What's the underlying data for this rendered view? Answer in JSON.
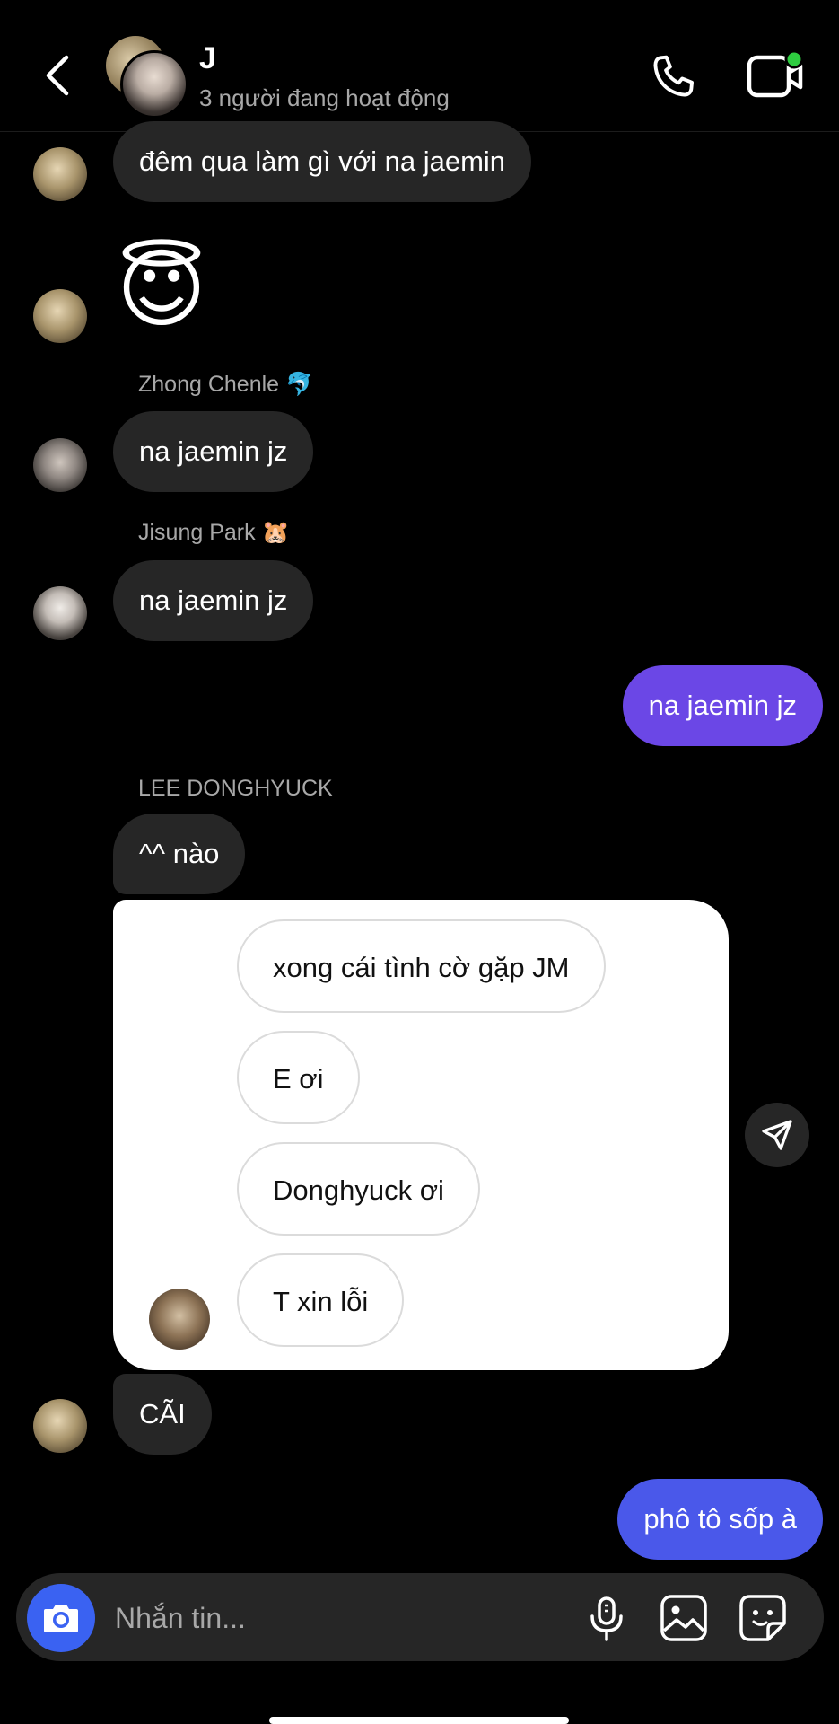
{
  "header": {
    "title": "J",
    "subtitle": "3 người đang hoạt động"
  },
  "messages": [
    {
      "text": "đêm qua làm gì với na jaemin"
    },
    {
      "emoji": "😇"
    },
    {
      "sender": "Zhong Chenle 🐬",
      "text": "na jaemin jz"
    },
    {
      "sender": "Jisung Park 🐹",
      "text": "na jaemin jz"
    },
    {
      "text": "na jaemin jz"
    },
    {
      "sender": "LEE DONGHYUCK",
      "text": "^^ nào"
    },
    {
      "text": "CÃI"
    },
    {
      "text": "phô tô sốp à"
    }
  ],
  "shared_card": {
    "lines": [
      "xong cái tình cờ gặp JM",
      "E ơi",
      "Donghyuck ơi",
      "T xin lỗi"
    ]
  },
  "composer": {
    "placeholder": "Nhắn tin..."
  },
  "colors": {
    "outgoing_purple": "#6b47e6",
    "outgoing_blue": "#4a58ea",
    "incoming": "#262626",
    "online_dot": "#2ecc40",
    "camera_button": "#3a62f2"
  },
  "icons": [
    "back-icon",
    "phone-icon",
    "video-call-icon",
    "send-icon",
    "camera-icon",
    "microphone-icon",
    "gallery-icon",
    "sticker-icon"
  ]
}
